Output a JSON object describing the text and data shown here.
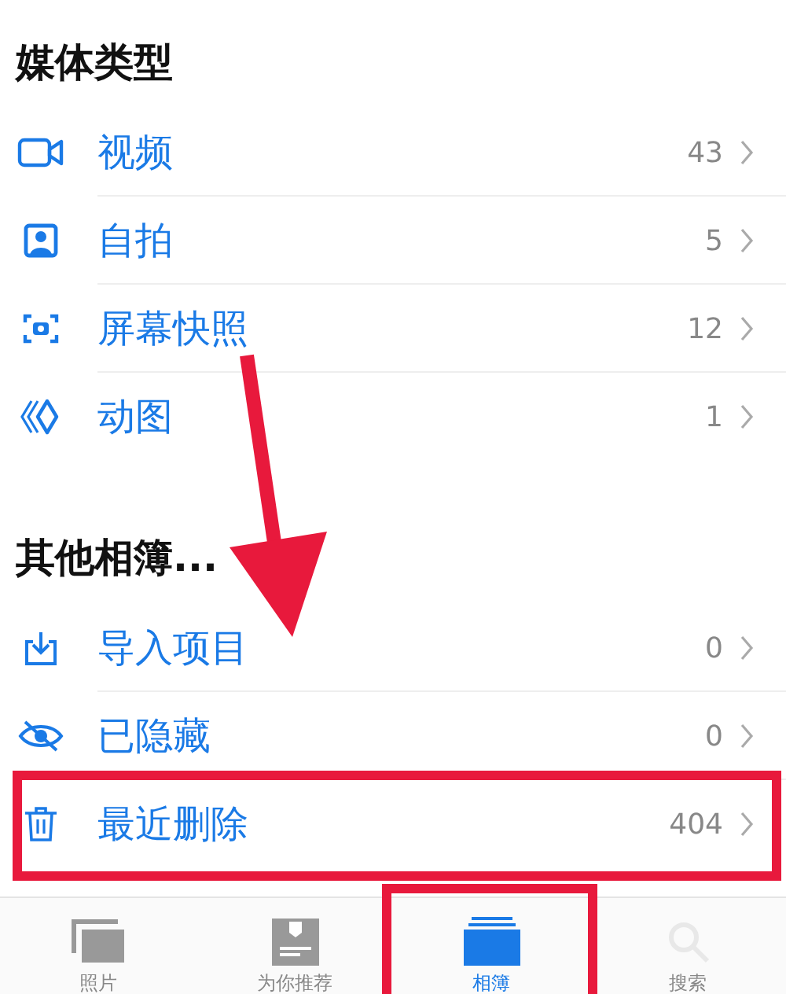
{
  "sections": [
    {
      "title": "媒体类型",
      "items": [
        {
          "kind": "video",
          "label": "视频",
          "count": "43",
          "highlighted": false
        },
        {
          "kind": "selfie",
          "label": "自拍",
          "count": "5",
          "highlighted": false
        },
        {
          "kind": "screenshot",
          "label": "屏幕快照",
          "count": "12",
          "highlighted": false
        },
        {
          "kind": "animated",
          "label": "动图",
          "count": "1",
          "highlighted": false
        }
      ]
    },
    {
      "title": "其他相簿...",
      "items": [
        {
          "kind": "import",
          "label": "导入项目",
          "count": "0",
          "highlighted": false
        },
        {
          "kind": "hidden",
          "label": "已隐藏",
          "count": "0",
          "highlighted": false
        },
        {
          "kind": "trash",
          "label": "最近删除",
          "count": "404",
          "highlighted": true
        }
      ]
    }
  ],
  "tab_bar": [
    {
      "kind": "photos",
      "label": "照片",
      "selected": false,
      "highlighted": false
    },
    {
      "kind": "for_you",
      "label": "为你推荐",
      "selected": false,
      "highlighted": false
    },
    {
      "kind": "albums",
      "label": "相簿",
      "selected": true,
      "highlighted": true
    },
    {
      "kind": "search",
      "label": "搜索",
      "selected": false,
      "highlighted": false
    }
  ]
}
